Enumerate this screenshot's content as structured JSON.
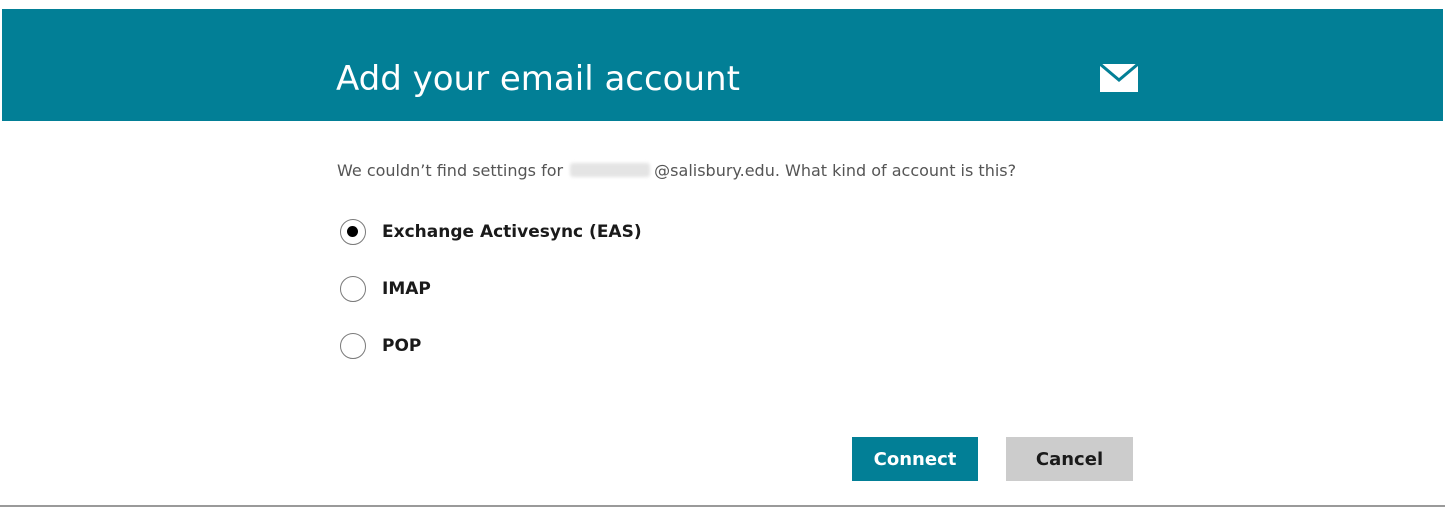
{
  "dialog": {
    "title": "Add your email account",
    "icon": "mail-icon",
    "message_prefix": "We couldn’t find settings for",
    "message_suffix": "@salisbury.edu. What kind of account is this?"
  },
  "options": [
    {
      "label": "Exchange Activesync (EAS)",
      "selected": true
    },
    {
      "label": "IMAP",
      "selected": false
    },
    {
      "label": "POP",
      "selected": false
    }
  ],
  "buttons": {
    "connect_label": "Connect",
    "cancel_label": "Cancel"
  },
  "colors": {
    "accent": "#027f96",
    "cancel_bg": "#cccccc",
    "header_text": "#ffffff"
  }
}
